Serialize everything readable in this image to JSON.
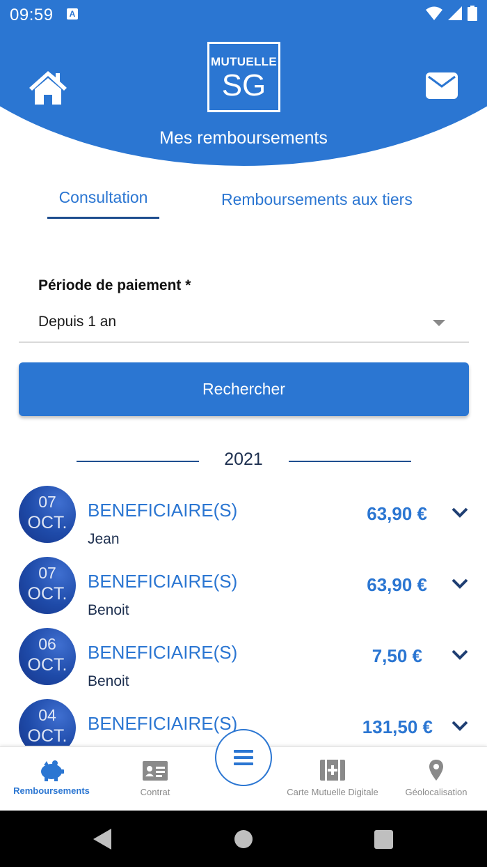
{
  "status_bar": {
    "time": "09:59",
    "notification": "A"
  },
  "header": {
    "logo_top": "MUTUELLE",
    "logo_bottom": "SG",
    "title": "Mes remboursements"
  },
  "tabs": [
    {
      "label": "Consultation",
      "active": true
    },
    {
      "label": "Remboursements aux tiers",
      "active": false
    }
  ],
  "form": {
    "period_label": "Période de paiement *",
    "period_value": "Depuis 1 an",
    "search_label": "Rechercher"
  },
  "year": "2021",
  "reimbursements": [
    {
      "day": "07",
      "month": "OCT.",
      "label": "BENEFICIAIRE(S)",
      "name": "Jean",
      "amount": "63,90 €"
    },
    {
      "day": "07",
      "month": "OCT.",
      "label": "BENEFICIAIRE(S)",
      "name": "Benoit",
      "amount": "63,90 €"
    },
    {
      "day": "06",
      "month": "OCT.",
      "label": "BENEFICIAIRE(S)",
      "name": "Benoit",
      "amount": "7,50 €"
    },
    {
      "day": "04",
      "month": "OCT.",
      "label": "BENEFICIAIRE(S)",
      "name": "",
      "amount": "131,50 €"
    }
  ],
  "bottom_nav": [
    {
      "label": "Remboursements",
      "icon": "piggy-bank-icon",
      "active": true
    },
    {
      "label": "Contrat",
      "icon": "id-card-icon",
      "active": false
    },
    {
      "label": "Carte Mutuelle Digitale",
      "icon": "medical-card-icon",
      "active": false
    },
    {
      "label": "Géolocalisation",
      "icon": "location-pin-icon",
      "active": false
    }
  ],
  "colors": {
    "primary": "#2b76d2",
    "dark_blue": "#1f4e8f",
    "circle": "#1e4aa8"
  }
}
